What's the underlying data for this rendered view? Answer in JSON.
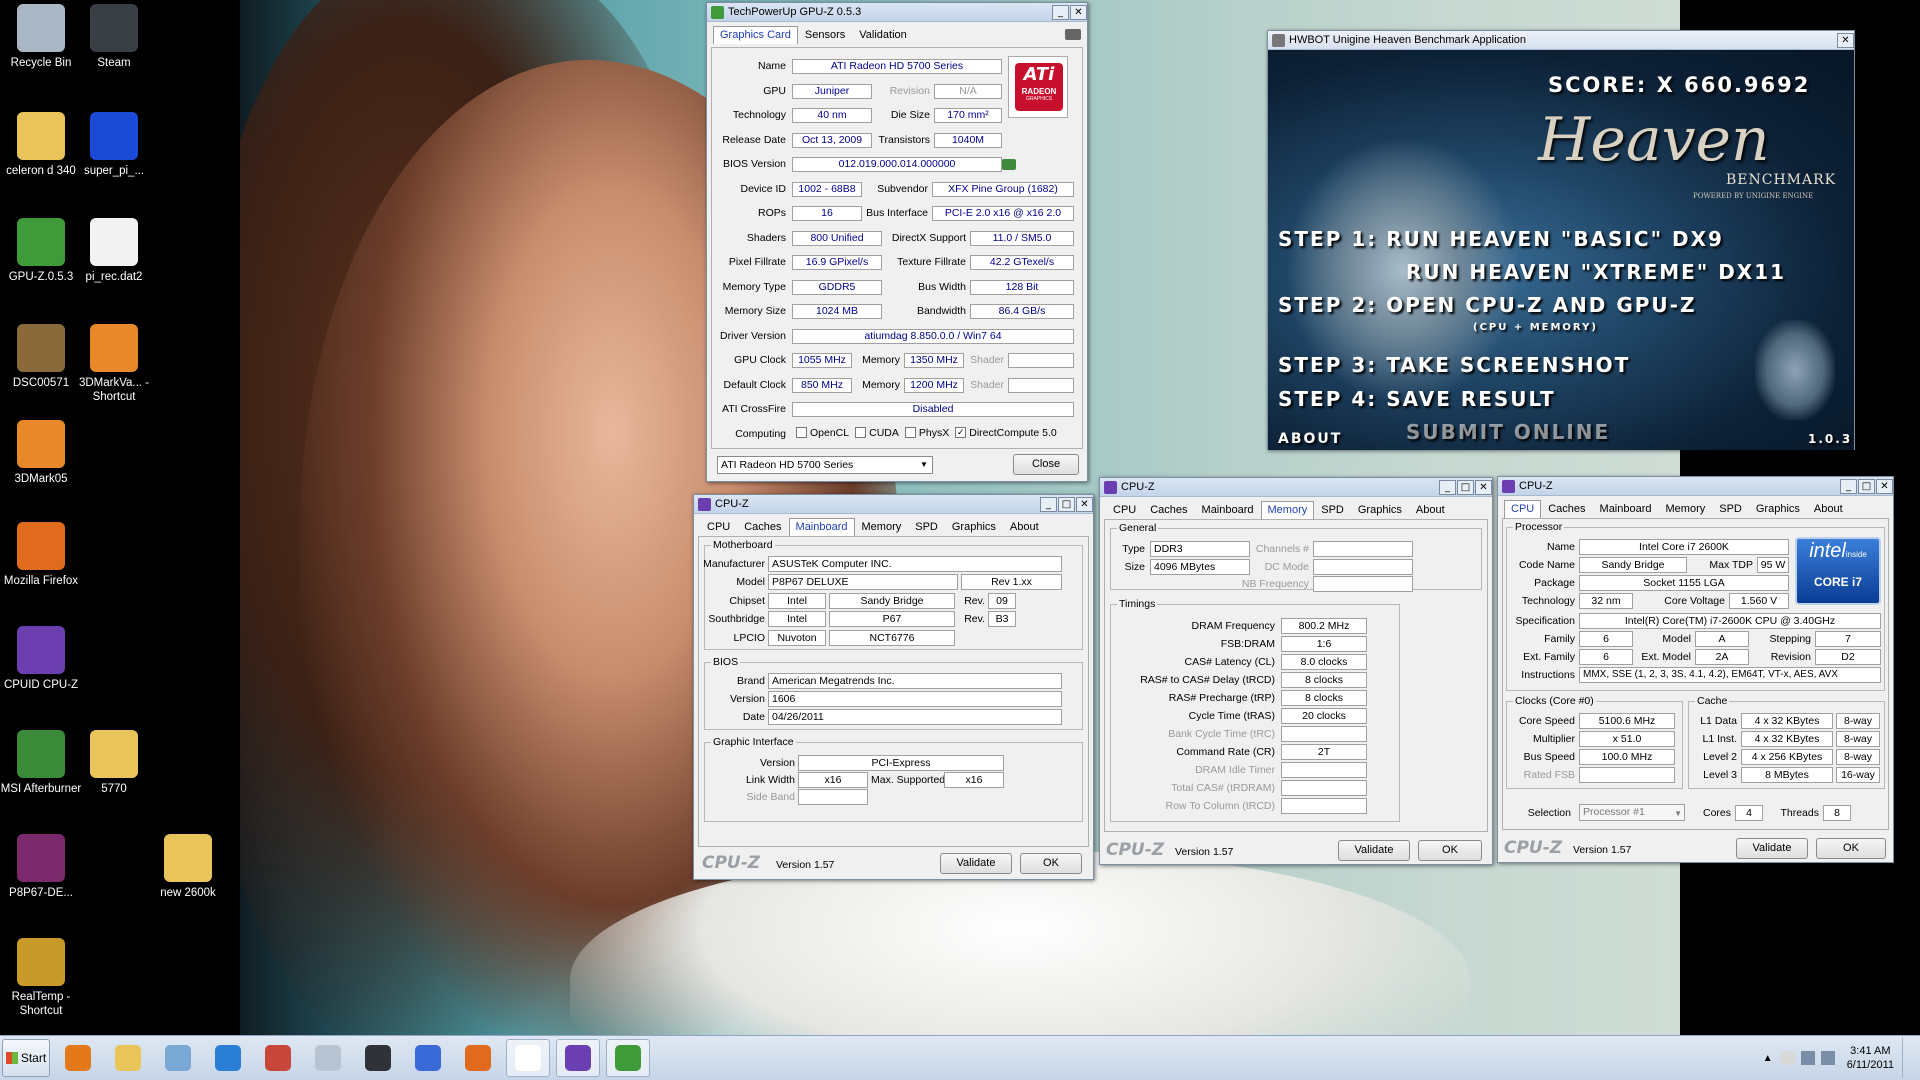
{
  "desktop_icons": [
    {
      "label": "Recycle Bin",
      "icon": "recycle-bin-icon",
      "color": "#a9b6c4"
    },
    {
      "label": "Steam",
      "icon": "steam-icon",
      "color": "#3a3f46"
    },
    {
      "label": "celeron d 340",
      "icon": "folder-icon",
      "color": "#e8c45a"
    },
    {
      "label": "super_pi_...",
      "icon": "super-pi-icon",
      "color": "#1b4bd6"
    },
    {
      "label": "GPU-Z.0.5.3",
      "icon": "gpuz-icon",
      "color": "#3f9a3a"
    },
    {
      "label": "pi_rec.dat2",
      "icon": "file-icon",
      "color": "#f2f2f2"
    },
    {
      "label": "DSC00571",
      "icon": "photo-icon",
      "color": "#8a6a3a"
    },
    {
      "label": "3DMarkVa... - Shortcut",
      "icon": "3dmark-icon",
      "color": "#e7892b"
    },
    {
      "label": "3DMark05",
      "icon": "3dmark05-icon",
      "color": "#e7892b"
    },
    {
      "label": "Mozilla Firefox",
      "icon": "firefox-icon",
      "color": "#e06b1e"
    },
    {
      "label": "CPUID CPU-Z",
      "icon": "cpuz-icon",
      "color": "#6b3fb0"
    },
    {
      "label": "MSI Afterburner",
      "icon": "afterburner-icon",
      "color": "#3a8a3a"
    },
    {
      "label": "5770",
      "icon": "folder-icon",
      "color": "#e8c45a"
    },
    {
      "label": "P8P67-DE...",
      "icon": "winrar-icon",
      "color": "#7a2a6a"
    },
    {
      "label": "new 2600k",
      "icon": "folder-icon",
      "color": "#e8c45a"
    },
    {
      "label": "RealTemp - Shortcut",
      "icon": "realtemp-icon",
      "color": "#c89a2a"
    }
  ],
  "gpuz": {
    "title": "TechPowerUp GPU-Z 0.5.3",
    "tabs": [
      "Graphics Card",
      "Sensors",
      "Validation"
    ],
    "logo_text": "ATi",
    "logo_sub": "RADEON",
    "logo_sub2": "GRAPHICS",
    "accent": "#c8102e",
    "name_label": "Name",
    "name": "ATI Radeon HD 5700 Series",
    "gpu_label": "GPU",
    "gpu": "Juniper",
    "revision_label": "Revision",
    "revision": "N/A",
    "technology_label": "Technology",
    "technology": "40 nm",
    "die_size_label": "Die Size",
    "die_size": "170 mm²",
    "release_label": "Release Date",
    "release_date": "Oct 13, 2009",
    "transistors_label": "Transistors",
    "transistors": "1040M",
    "bios_label": "BIOS Version",
    "bios": "012.019.000.014.000000",
    "device_label": "Device ID",
    "device_id": "1002 - 68B8",
    "subvendor_label": "Subvendor",
    "subvendor": "XFX Pine Group (1682)",
    "rops_label": "ROPs",
    "rops": "16",
    "bus_interface_label": "Bus Interface",
    "bus_interface": "PCI-E 2.0 x16 @ x16 2.0",
    "shaders_label": "Shaders",
    "shaders": "800 Unified",
    "directx_label": "DirectX Support",
    "directx": "11.0 / SM5.0",
    "pixel_label": "Pixel Fillrate",
    "pixel_fillrate": "16.9 GPixel/s",
    "texture_label": "Texture Fillrate",
    "texture_fillrate": "42.2 GTexel/s",
    "memtype_label": "Memory Type",
    "memory_type": "GDDR5",
    "buswidth_label": "Bus Width",
    "bus_width": "128 Bit",
    "memsize_label": "Memory Size",
    "memory_size": "1024 MB",
    "bandwidth_label": "Bandwidth",
    "bandwidth": "86.4 GB/s",
    "driver_label": "Driver Version",
    "driver": "atiumdag 8.850.0.0 / Win7 64",
    "gpuclock_label": "GPU Clock",
    "gpu_clock": "1055 MHz",
    "memory_label": "Memory",
    "memory_clock": "1350 MHz",
    "shader_label": "Shader",
    "default_label": "Default Clock",
    "default_clock": "850 MHz",
    "default_memory": "1200 MHz",
    "crossfire_label": "ATI CrossFire",
    "crossfire": "Disabled",
    "computing_label": "Computing",
    "computing": [
      {
        "label": "OpenCL",
        "checked": false
      },
      {
        "label": "CUDA",
        "checked": false
      },
      {
        "label": "PhysX",
        "checked": false
      },
      {
        "label": "DirectCompute 5.0",
        "checked": true
      }
    ],
    "selected_card": "ATI Radeon HD 5700 Series",
    "close_label": "Close"
  },
  "heaven": {
    "title": "HWBOT Unigine Heaven Benchmark Application",
    "score": "SCORE: X 660.9692",
    "logo": "Heaven",
    "logo_sub": "BENCHMARK",
    "logo_powered": "POWERED BY UNIGINE ENGINE",
    "step1a": "STEP 1:  RUN HEAVEN \"BASIC\" DX9",
    "step1b": "RUN HEAVEN \"XTREME\" DX11",
    "step2": "STEP 2: OPEN CPU-Z  AND  GPU-Z",
    "step2_note": "(CPU + MEMORY)",
    "step3": "STEP 3: TAKE SCREENSHOT",
    "step4": "STEP 4: SAVE RESULT",
    "submit": "SUBMIT ONLINE",
    "about": "ABOUT",
    "version": "1.0.3"
  },
  "cpuz_mb": {
    "title": "CPU-Z",
    "tabs": [
      "CPU",
      "Caches",
      "Mainboard",
      "Memory",
      "SPD",
      "Graphics",
      "About"
    ],
    "active_tab": "Mainboard",
    "motherboard_group": "Motherboard",
    "manufacturer_label": "Manufacturer",
    "manufacturer": "ASUSTeK Computer INC.",
    "model_label": "Model",
    "model": "P8P67 DELUXE",
    "model_rev": "Rev 1.xx",
    "chipset_label": "Chipset",
    "chipset_vendor": "Intel",
    "chipset": "Sandy Bridge",
    "rev_label": "Rev.",
    "chipset_rev": "09",
    "southbridge_label": "Southbridge",
    "sb_vendor": "Intel",
    "southbridge": "P67",
    "sb_rev": "B3",
    "lpcio_label": "LPCIO",
    "lpcio_vendor": "Nuvoton",
    "lpcio": "NCT6776",
    "bios_group": "BIOS",
    "brand_label": "Brand",
    "brand": "American Megatrends Inc.",
    "version_label": "Version",
    "bios_version": "1606",
    "date_label": "Date",
    "bios_date": "04/26/2011",
    "gi_group": "Graphic Interface",
    "gi_version_label": "Version",
    "gi_version": "PCI-Express",
    "link_width_label": "Link Width",
    "link_width": "x16",
    "max_supported_label": "Max. Supported",
    "max_supported": "x16",
    "side_band_label": "Side Band",
    "brand_logo": "CPU-Z",
    "version_text": "Version 1.57",
    "validate_label": "Validate",
    "ok_label": "OK"
  },
  "cpuz_mem": {
    "title": "CPU-Z",
    "tabs": [
      "CPU",
      "Caches",
      "Mainboard",
      "Memory",
      "SPD",
      "Graphics",
      "About"
    ],
    "active_tab": "Memory",
    "general_group": "General",
    "type_label": "Type",
    "type": "DDR3",
    "size_label": "Size",
    "size": "4096 MBytes",
    "channels_label": "Channels #",
    "dcmode_label": "DC Mode",
    "nbfreq_label": "NB Frequency",
    "timings_group": "Timings",
    "timings": [
      {
        "label": "DRAM Frequency",
        "value": "800.2 MHz",
        "dim": false
      },
      {
        "label": "FSB:DRAM",
        "value": "1:6",
        "dim": false
      },
      {
        "label": "CAS# Latency (CL)",
        "value": "8.0 clocks",
        "dim": false
      },
      {
        "label": "RAS# to CAS# Delay (tRCD)",
        "value": "8 clocks",
        "dim": false
      },
      {
        "label": "RAS# Precharge (tRP)",
        "value": "8 clocks",
        "dim": false
      },
      {
        "label": "Cycle Time (tRAS)",
        "value": "20 clocks",
        "dim": false
      },
      {
        "label": "Bank Cycle Time (tRC)",
        "value": "",
        "dim": true
      },
      {
        "label": "Command Rate (CR)",
        "value": "2T",
        "dim": false
      },
      {
        "label": "DRAM Idle Timer",
        "value": "",
        "dim": true
      },
      {
        "label": "Total CAS# (tRDRAM)",
        "value": "",
        "dim": true
      },
      {
        "label": "Row To Column (tRCD)",
        "value": "",
        "dim": true
      }
    ],
    "brand_logo": "CPU-Z",
    "version_text": "Version 1.57",
    "validate_label": "Validate",
    "ok_label": "OK"
  },
  "cpuz_cpu": {
    "title": "CPU-Z",
    "tabs": [
      "CPU",
      "Caches",
      "Mainboard",
      "Memory",
      "SPD",
      "Graphics",
      "About"
    ],
    "active_tab": "CPU",
    "processor_group": "Processor",
    "name_label": "Name",
    "name": "Intel Core i7 2600K",
    "codename_label": "Code Name",
    "codename": "Sandy Bridge",
    "maxtdp_label": "Max TDP",
    "maxtdp": "95 W",
    "package_label": "Package",
    "package": "Socket 1155 LGA",
    "technology_label": "Technology",
    "technology": "32 nm",
    "core_voltage_label": "Core Voltage",
    "core_voltage": "1.560 V",
    "spec_label": "Specification",
    "spec": "Intel(R) Core(TM) i7-2600K CPU @ 3.40GHz",
    "family_label": "Family",
    "family": "6",
    "model_label": "Model",
    "model": "A",
    "stepping_label": "Stepping",
    "stepping": "7",
    "extfamily_label": "Ext. Family",
    "extfamily": "6",
    "extmodel_label": "Ext. Model",
    "extmodel": "2A",
    "revision_label": "Revision",
    "revision": "D2",
    "instructions_label": "Instructions",
    "instructions": "MMX, SSE (1, 2, 3, 3S, 4.1, 4.2), EM64T, VT-x, AES, AVX",
    "clocks_group": "Clocks (Core #0)",
    "core_speed_label": "Core Speed",
    "core_speed": "5100.6 MHz",
    "multiplier_label": "Multiplier",
    "multiplier": "x 51.0",
    "bus_speed_label": "Bus Speed",
    "bus_speed": "100.0 MHz",
    "rated_fsb_label": "Rated FSB",
    "cache_group": "Cache",
    "caches": [
      {
        "label": "L1 Data",
        "size": "4 x 32 KBytes",
        "way": "8-way"
      },
      {
        "label": "L1 Inst.",
        "size": "4 x 32 KBytes",
        "way": "8-way"
      },
      {
        "label": "Level 2",
        "size": "4 x 256 KBytes",
        "way": "8-way"
      },
      {
        "label": "Level 3",
        "size": "8 MBytes",
        "way": "16-way"
      }
    ],
    "selection_label": "Selection",
    "selection": "Processor #1",
    "cores_label": "Cores",
    "cores": "4",
    "threads_label": "Threads",
    "threads": "8",
    "intel_logo": "intel",
    "intel_inside": "inside",
    "intel_core": "CORE i7",
    "brand_logo": "CPU-Z",
    "version_text": "Version 1.57",
    "validate_label": "Validate",
    "ok_label": "OK"
  },
  "taskbar": {
    "start_label": "Start",
    "apps": [
      {
        "icon": "media-player-icon",
        "color": "#e3791b"
      },
      {
        "icon": "explorer-icon",
        "color": "#e8c45a"
      },
      {
        "icon": "notepad-icon",
        "color": "#7aa8d4"
      },
      {
        "icon": "ie-icon",
        "color": "#2a7fd4"
      },
      {
        "icon": "snipping-tool-icon",
        "color": "#c8463a"
      },
      {
        "icon": "calculator-icon",
        "color": "#b8c4d2"
      },
      {
        "icon": "steam-icon",
        "color": "#2f3338"
      },
      {
        "icon": "itunes-icon",
        "color": "#3a6ad8"
      },
      {
        "icon": "firefox-icon",
        "color": "#e06b1e"
      },
      {
        "icon": "heaven-icon",
        "color": "#ffffff"
      },
      {
        "icon": "cpuz-icon",
        "color": "#6b3fb0"
      },
      {
        "icon": "gpuz-icon",
        "color": "#3f9a3a"
      }
    ],
    "time": "3:41 AM",
    "date": "6/11/2011"
  }
}
